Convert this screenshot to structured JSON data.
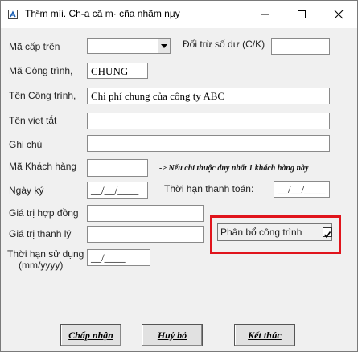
{
  "window": {
    "title": "Thªm míi. Ch-a cã m· cña nhãm nµy"
  },
  "form": {
    "ma_cap_tren": {
      "label": "Mã cấp trên",
      "value": ""
    },
    "doi_tru": {
      "label": "Đối trừ số dư (C/K)",
      "value": ""
    },
    "ma_cong_trinh": {
      "label": "Mã Công trình,",
      "value": "CHUNG"
    },
    "ten_cong_trinh": {
      "label": "Tên Công trình,",
      "value": "Chi phí chung của công ty ABC"
    },
    "ten_viet_tat": {
      "label": "Tên viet tắt",
      "value": ""
    },
    "ghi_chu": {
      "label": "Ghi chú",
      "value": ""
    },
    "ma_khach_hang": {
      "label": "Mã Khách hàng",
      "value": "",
      "hint": "-> Nếu chỉ thuộc duy nhất 1 khách hàng này"
    },
    "ngay_ky": {
      "label": "Ngày ký",
      "value": "__/__/____"
    },
    "thoi_han_thanh_toan": {
      "label": "Thời hạn thanh toán:",
      "value": "__/__/____"
    },
    "gia_tri_hop_dong": {
      "label": "Giá trị hợp đồng",
      "value": ""
    },
    "gia_tri_thanh_ly": {
      "label": "Giá trị thanh lý",
      "value": ""
    },
    "phan_bo_cong_trinh": {
      "label": "Phân bổ công trình",
      "checked": true
    },
    "thoi_han_su_dung": {
      "label": "Thời hạn sử dụng",
      "label2": "(mm/yyyy)",
      "value": "__/____"
    }
  },
  "buttons": {
    "accept": "Chấp nhận",
    "cancel": "Huỷ bỏ",
    "finish": "Kết thúc"
  },
  "colors": {
    "highlight": "#e0141c"
  }
}
